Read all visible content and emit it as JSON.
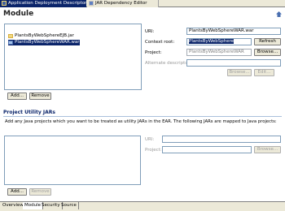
{
  "tabs": {
    "active": "Application Deployment Descriptor",
    "inactive": "JAR Dependency Editor"
  },
  "module": {
    "title": "Module",
    "items": [
      {
        "label": "PlantsByWebSphereEJB.jar"
      },
      {
        "label": "PlantsByWebSphereWAR.war"
      }
    ],
    "add_label": "Add...",
    "remove_label": "Remove",
    "uri_label": "URI:",
    "uri_value": "PlantsByWebSphereWAR.war",
    "context_root_label": "Context root:",
    "context_root_value": "PlantsByWebSphere",
    "refresh_label": "Refresh",
    "project_label": "Project:",
    "project_value": "PlantsByWebSphereWAR",
    "browse_label": "Browse...",
    "alt_desc_label": "Alternate descriptor:",
    "alt_browse_label": "Browse...",
    "alt_edit_label": "Edit..."
  },
  "utility": {
    "title": "Project Utility JARs",
    "description": "Add any Java projects which you want to be treated as utility JARs in the EAR. The following JARs are mapped to Java projects:",
    "uri_label": "URI:",
    "project_label": "Project:",
    "browse_label": "Browse...",
    "add_label": "Add...",
    "remove_label": "Remove"
  },
  "bottom_tabs": [
    "Overview",
    "Module",
    "Security",
    "Source"
  ]
}
